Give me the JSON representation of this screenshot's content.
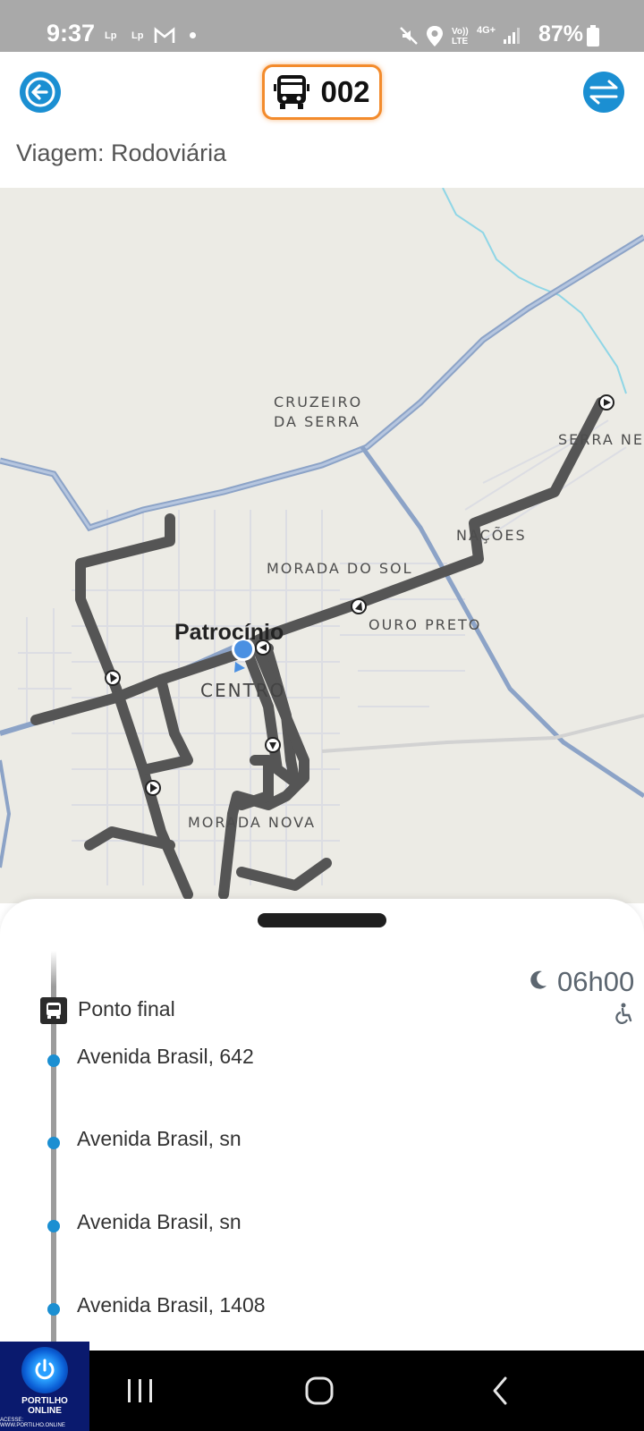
{
  "status_bar": {
    "time": "9:37",
    "notif_1": "Lp",
    "notif_2": "Lp",
    "network_1": "Vo)) LTE",
    "network_2": "4G+",
    "battery": "87%"
  },
  "header": {
    "line_number": "002",
    "trip_label": "Viagem: Rodoviária",
    "accent_color": "#1b8fd2",
    "badge_color": "#f38b2c"
  },
  "map": {
    "city": "Patrocínio",
    "labels": {
      "cruzeiro_1": "CRUZEIRO",
      "cruzeiro_2": "DA SERRA",
      "serra_negra": "SERRA NE",
      "nacoes": "NAÇÕES",
      "morada_do_sol": "MORADA DO SOL",
      "ouro_preto": "OURO PRETO",
      "centro": "CENTRO",
      "morada_nova": "MORADA NOVA"
    }
  },
  "stops": [
    {
      "label": "Ponto final",
      "type": "terminal"
    },
    {
      "label": "Avenida Brasil, 642",
      "type": "stop"
    },
    {
      "label": "Avenida Brasil, sn",
      "type": "stop"
    },
    {
      "label": "Avenida Brasil, sn",
      "type": "stop"
    },
    {
      "label": "Avenida Brasil, 1408",
      "type": "stop"
    }
  ],
  "schedule": {
    "time": "06h00",
    "period_icon": "moon-icon",
    "accessibility_icon": "wheelchair-icon"
  },
  "watermark": {
    "name_1": "PORTILHO",
    "name_2": "ONLINE",
    "url": "ACESSE: WWW.PORTILHO.ONLINE"
  }
}
